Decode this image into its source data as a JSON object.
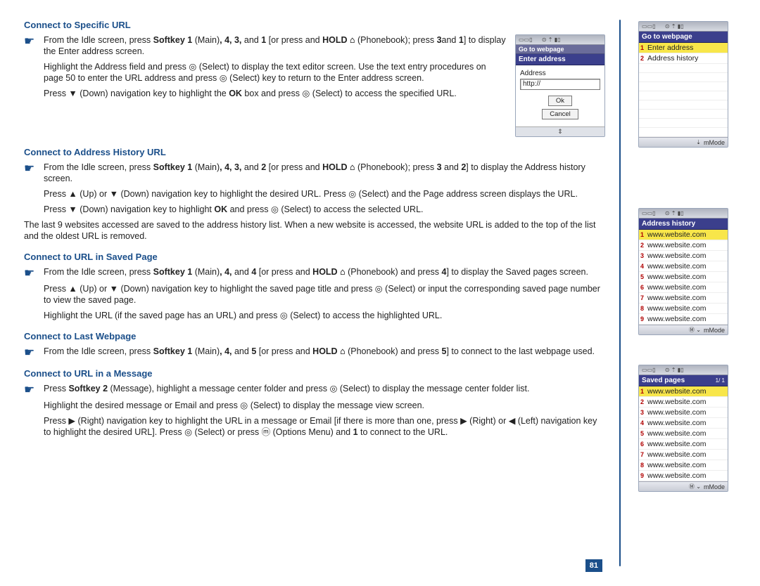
{
  "page_number": "81",
  "sections": {
    "s1": {
      "title": "Connect to Specific URL",
      "b1_pre": "From the Idle screen, press ",
      "b1_sk1": "Softkey 1",
      "b1_main": " (Main)",
      "b1_keys": ", 4, 3,",
      "b1_and": " and ",
      "b1_1": "1",
      "b1_or": " [or press and ",
      "b1_hold": "HOLD",
      "b1_pb": " (Phonebook); press ",
      "b1_3": "3",
      "b1_and2": "and ",
      "b1_12": "1",
      "b1_end": "] to display the Enter address screen.",
      "i1": "Highlight the Address field and press ◎ (Select) to display the text editor screen. Use the text entry procedures on page 50 to enter the URL address and press ◎ (Select) key to return to the Enter address screen.",
      "i2a": "Press ▼ (Down) navigation key to highlight the ",
      "i2b": "OK",
      "i2c": " box and press ◎ (Select) to access the specified URL."
    },
    "s2": {
      "title": "Connect to Address History URL",
      "b1_pre": "From the Idle screen, press ",
      "b1_sk1": "Softkey 1",
      "b1_main": " (Main)",
      "b1_keys": ", 4, 3,",
      "b1_and": " and ",
      "b1_2": "2",
      "b1_or": " [or press and ",
      "b1_hold": "HOLD",
      "b1_pb": " (Phonebook); press ",
      "b1_3": "3",
      "b1_and2": " and ",
      "b1_22": "2",
      "b1_end": "] to display the Address history screen.",
      "i1": "Press ▲ (Up) or ▼ (Down) navigation key to highlight the desired URL. Press ◎ (Select) and the Page address screen displays the URL.",
      "i2a": "Press ▼ (Down) navigation key to highlight ",
      "i2b": "OK",
      "i2c": " and press ◎ (Select) to access the selected URL.",
      "p1": "The last 9 websites accessed are saved to the address history list. When a new website is accessed, the website URL is added to the top of the list and the oldest URL is removed."
    },
    "s3": {
      "title": "Connect to URL in Saved Page",
      "b1_pre": "From the Idle screen, press ",
      "b1_sk1": "Softkey 1",
      "b1_main": " (Main)",
      "b1_keys": ", 4,",
      "b1_and": " and ",
      "b1_4": "4",
      "b1_or": " [or press and ",
      "b1_hold": "HOLD",
      "b1_pb": " (Phonebook) and press ",
      "b1_42": "4",
      "b1_end": "] to display the Saved pages screen.",
      "i1": "Press ▲ (Up) or ▼ (Down) navigation key to highlight the saved page title and press ◎ (Select) or input the corresponding saved page number to view the saved page.",
      "i2": "Highlight the URL (if the saved page has an URL) and press ◎ (Select) to access the highlighted URL."
    },
    "s4": {
      "title": "Connect to Last Webpage",
      "b1_pre": "From the Idle screen, press ",
      "b1_sk1": "Softkey 1",
      "b1_main": " (Main)",
      "b1_keys": ", 4,",
      "b1_and": " and ",
      "b1_5": "5",
      "b1_or": " [or press and ",
      "b1_hold": "HOLD",
      "b1_pb": " (Phonebook) and press ",
      "b1_52": "5",
      "b1_end": "] to connect to the last webpage used."
    },
    "s5": {
      "title": "Connect to URL in a Message",
      "b1_pre": "Press ",
      "b1_sk2": "Softkey 2",
      "b1_msg": " (Message), highlight a message center folder and press ◎ (Select) to display the message center folder list.",
      "i1": "Highlight the desired message or Email and press ◎ (Select) to display the message view screen.",
      "i2a": "Press ▶ (Right) navigation key to highlight the URL in a message or Email [if there is more than one, press ▶ (Right) or ◀ (Left) navigation key to highlight the desired URL]. Press ◎ (Select) or press ⓜ (Options Menu) and ",
      "i2b": "1",
      "i2c": " to connect to the URL."
    }
  },
  "phone1": {
    "title": "Enter address",
    "label": "Address",
    "value": "http://",
    "ok": "Ok",
    "cancel": "Cancel",
    "scroll": "▲    ▼"
  },
  "phone2": {
    "title": "Go to webpage",
    "items": [
      "Enter address",
      "Address history"
    ],
    "selected": 0,
    "footer_icon": "⇣",
    "footer": "mMode"
  },
  "phone3": {
    "title": "Address history",
    "items": [
      "www.website.com",
      "www.website.com",
      "www.website.com",
      "www.website.com",
      "www.website.com",
      "www.website.com",
      "www.website.com",
      "www.website.com",
      "www.website.com"
    ],
    "selected": 0,
    "footer_icon": "Ⓜ ⌄",
    "footer": "mMode"
  },
  "phone4": {
    "title": "Saved pages",
    "counter": "1/ 1",
    "items": [
      "www.website.com",
      "www.website.com",
      "www.website.com",
      "www.website.com",
      "www.website.com",
      "www.website.com",
      "www.website.com",
      "www.website.com",
      "www.website.com"
    ],
    "selected": 0,
    "footer_icon": "Ⓜ ⌄",
    "footer": "mMode"
  }
}
